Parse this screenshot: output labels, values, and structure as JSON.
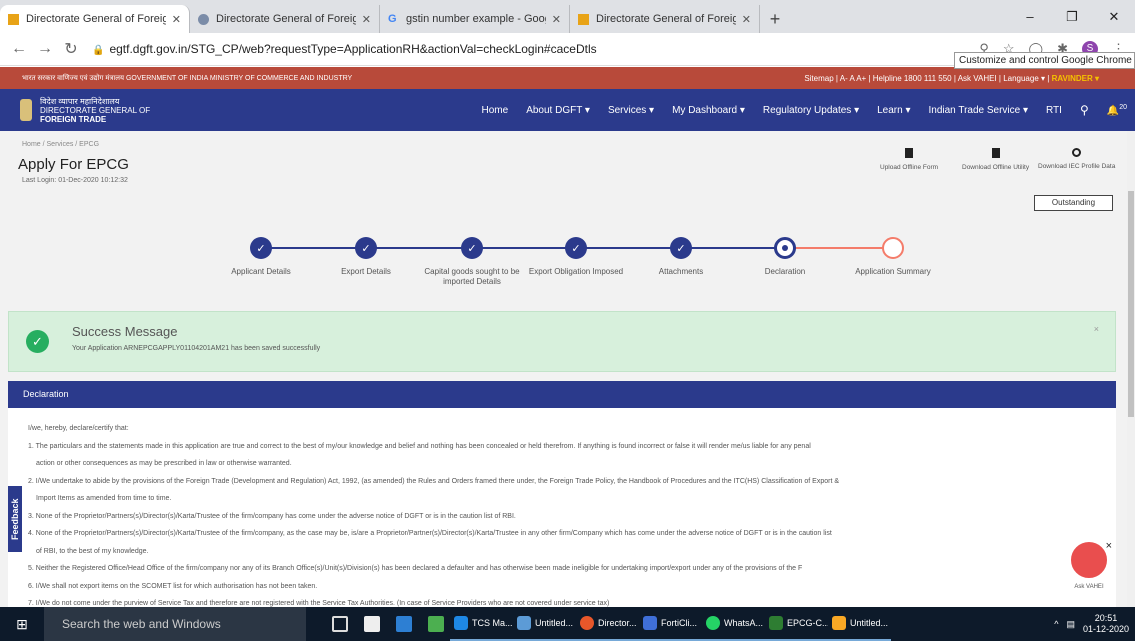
{
  "browser": {
    "tabs": [
      {
        "title": "Directorate General of Foreign T",
        "active": true
      },
      {
        "title": "Directorate General of Foreign T",
        "active": false
      },
      {
        "title": "gstin number example - Google",
        "active": false
      },
      {
        "title": "Directorate General of Foreign T",
        "active": false
      }
    ],
    "new_tab": "+",
    "url": "egtf.dgft.gov.in/STG_CP/web?requestType=ApplicationRH&actionVal=checkLogin#caceDtls",
    "tooltip": "Customize and control Google Chrome",
    "profile_initial": "S",
    "window_controls": [
      "–",
      "❐",
      "✕"
    ]
  },
  "govbar": {
    "left": "भारत सरकार  वाणिज्य एवं उद्योग मंत्रालय  GOVERNMENT OF INDIA  MINISTRY OF COMMERCE AND INDUSTRY",
    "right_prefix": "Sitemap | A-  A  A+ | Helpline 1800 111 550 | Ask VAHEI | Language ▾ |",
    "user": "RAVINDER ▾"
  },
  "header": {
    "org_hindi": "विदेश व्यापार महानिदेशालय",
    "org_line1": "DIRECTORATE GENERAL OF",
    "org_line2": "FOREIGN TRADE",
    "menu": [
      "Home",
      "About DGFT ▾",
      "Services ▾",
      "My Dashboard ▾",
      "Regulatory Updates ▾",
      "Learn ▾",
      "Indian Trade Service ▾",
      "RTI"
    ],
    "search_icon": "⚲",
    "bell_count": "20"
  },
  "page": {
    "breadcrumb": "Home  /  Services  /  EPCG",
    "title": "Apply For EPCG",
    "last_login": "Last Login: 01-Dec-2020 10:12:32",
    "utilities": [
      "Upload Offline Form",
      "Download Offline Utility",
      "Download IEC Profile Data"
    ],
    "outstanding_button": "Outstanding"
  },
  "steps": [
    {
      "label": "Applicant Details",
      "state": "done"
    },
    {
      "label": "Export Details",
      "state": "done"
    },
    {
      "label": "Capital goods sought to be imported Details",
      "state": "done"
    },
    {
      "label": "Export Obligation Imposed",
      "state": "done"
    },
    {
      "label": "Attachments",
      "state": "done"
    },
    {
      "label": "Declaration",
      "state": "current"
    },
    {
      "label": "Application Summary",
      "state": "next"
    }
  ],
  "success": {
    "heading": "Success Message",
    "message": "Your Application ARNEPCGAPPLY01104201AM21 has been saved successfully",
    "close": "×"
  },
  "declaration": {
    "heading": "Declaration",
    "lines": [
      "I/we, hereby, declare/certify that:",
      "1. The particulars and the statements made in this application are true and correct to the best of my/our knowledge and belief and nothing has been concealed or held therefrom. If anything is found incorrect or false it will render me/us liable for any penal",
      "action or other consequences as may be prescribed in law or otherwise warranted.",
      "2. I/We undertake to abide by the provisions of the Foreign Trade (Development and Regulation) Act, 1992, (as amended) the Rules and Orders framed there under, the Foreign Trade Policy, the Handbook of Procedures and the ITC(HS) Classification of Export &",
      "Import Items as amended from time to time.",
      "3. None of the Proprietor/Partners(s)/Director(s)/Karta/Trustee of the firm/company has come under the adverse notice of DGFT or is in the caution list of RBI.",
      "4. None of the Proprietor/Partners(s)/Director(s)/Karta/Trustee of the firm/company, as the case may be, is/are a Proprietor/Partner(s)/Director(s)/Karta/Trustee in any other firm/Company which has come under the adverse notice of DGFT or is in the caution list",
      "of RBI, to the best of my knowledge.",
      "5. Neither the Registered Office/Head Office of the firm/company nor any of its Branch Office(s)/Unit(s)/Division(s) has been declared a defaulter and has otherwise been made ineligible for undertaking import/export under any of the provisions of the F",
      "6. I/We shall not export items on the SCOMET list for which authorisation has not been taken.",
      "7. I/We do not come under the purview of Service Tax and therefore are not registered with the Service Tax Authorities. (In case of Service Providers who are not covered under service tax)"
    ]
  },
  "feedback_tab": "Feedback",
  "assistant": {
    "label": "Ask VAHEI",
    "close": "×"
  },
  "taskbar": {
    "search_placeholder": "Search the web and Windows",
    "apps": [
      {
        "label": "TCS Ma...",
        "color": "#1e88e5"
      },
      {
        "label": "Untitled...",
        "color": "#5c9bd6"
      },
      {
        "label": "Director...",
        "color": "#e8572a"
      },
      {
        "label": "FortiCli...",
        "color": "#3f6fd8"
      },
      {
        "label": "WhatsA...",
        "color": "#25d366"
      },
      {
        "label": "EPCG-C...",
        "color": "#2e7d32"
      },
      {
        "label": "Untitled...",
        "color": "#f9a825"
      }
    ],
    "time": "20:51",
    "date": "01-12-2020"
  }
}
